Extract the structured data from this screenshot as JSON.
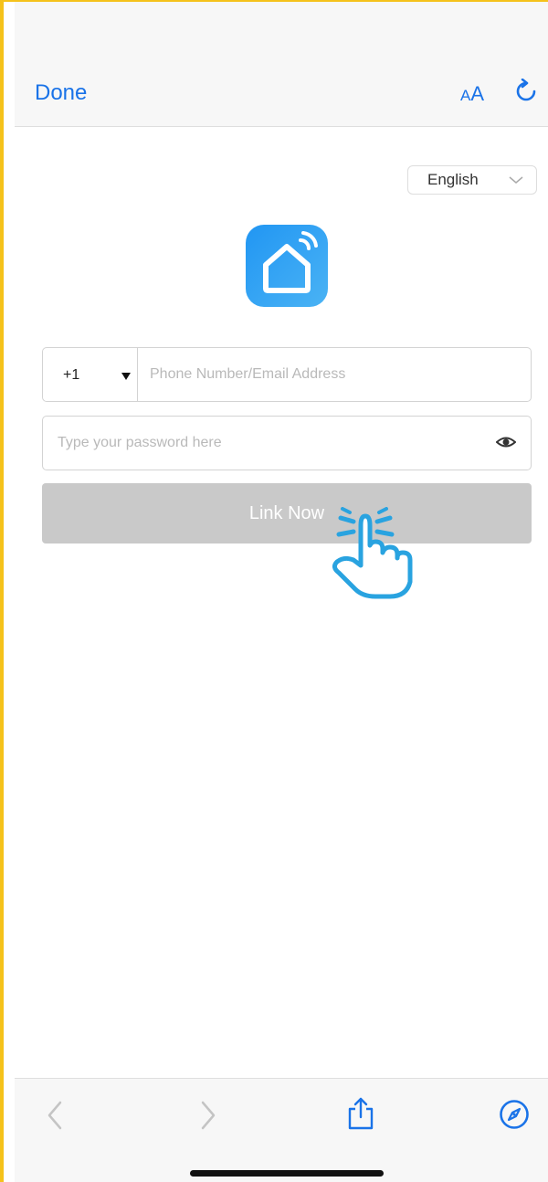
{
  "browser": {
    "done_label": "Done",
    "text_size_small": "A",
    "text_size_large": "A",
    "icons": {
      "reload": "reload-icon",
      "back": "chevron-left-icon",
      "forward": "chevron-right-icon",
      "share": "share-icon",
      "safari": "compass-icon"
    },
    "accent_color": "#1a73e8"
  },
  "page": {
    "language": "English",
    "logo_icon": "smart-home-logo-icon",
    "country_code": "+1",
    "phone_placeholder": "Phone Number/Email Address",
    "password_placeholder": "Type your password here",
    "link_button_label": "Link Now",
    "button_color": "#c9c9c9",
    "logo_color": "#2196f3",
    "overlay_icon": "tap-hand-icon"
  }
}
